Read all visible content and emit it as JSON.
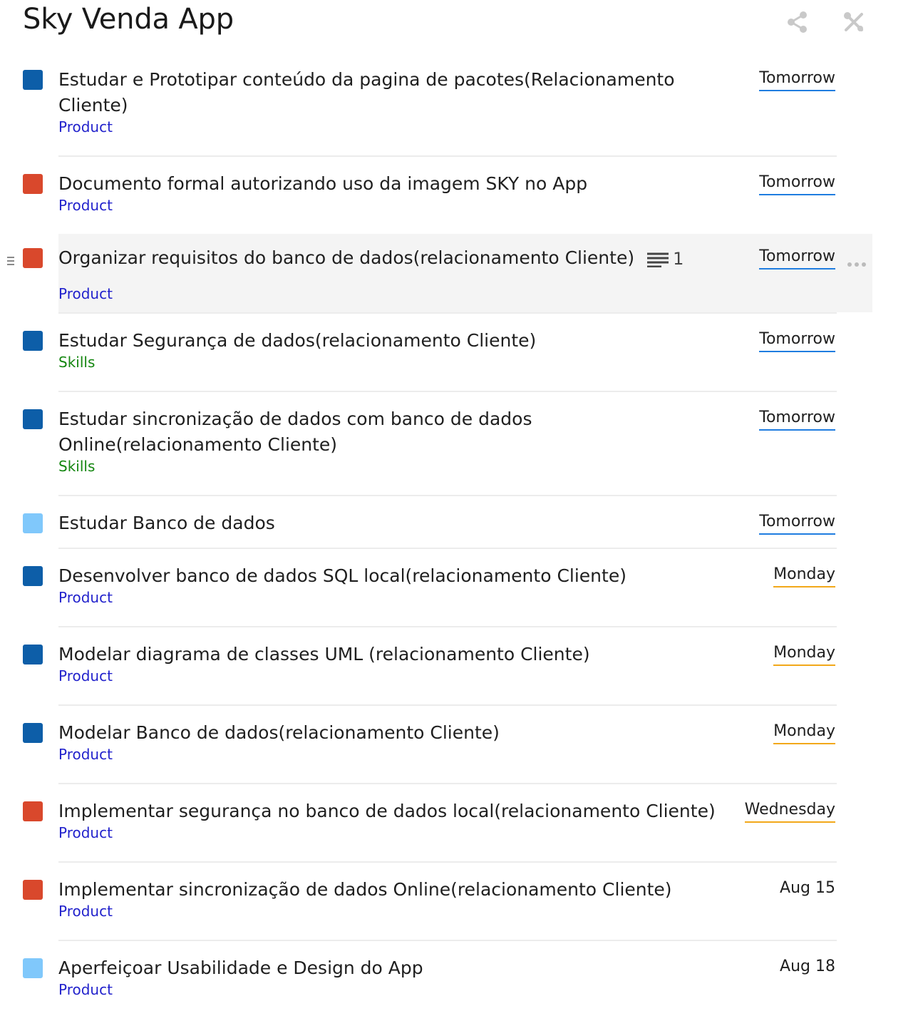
{
  "app": {
    "title": "Sky Venda App"
  },
  "colors": {
    "blue": "#0d5ea8",
    "red": "#d9482c",
    "light_blue": "#80c8fb",
    "product_tag": "#2222cc",
    "skills_tag": "#13860f",
    "tomorrow_underline": "#1f7de0",
    "weekday_underline": "#f2a81a"
  },
  "header": {
    "share_icon": "share-icon",
    "tools_icon": "tools-icon"
  },
  "tasks": [
    {
      "name": "Estudar e Prototipar conteúdo da pagina de pacotes(Relacionamento Cliente)",
      "project": "Product",
      "due": "Tomorrow",
      "color": "blue"
    },
    {
      "name": "Documento formal autorizando uso da imagem SKY no App",
      "project": "Product",
      "due": "Tomorrow",
      "color": "red"
    },
    {
      "name": "Organizar requisitos do banco de dados(relacionamento Cliente)",
      "project": "Product",
      "due": "Tomorrow",
      "color": "red",
      "comments": "1"
    },
    {
      "name": "Estudar Segurança de dados(relacionamento Cliente)",
      "project": "Skills",
      "due": "Tomorrow",
      "color": "blue"
    },
    {
      "name": "Estudar sincronização de dados com banco de dados Online(relacionamento Cliente)",
      "project": "Skills",
      "due": "Tomorrow",
      "color": "blue"
    },
    {
      "name": "Estudar Banco de dados",
      "project": "",
      "due": "Tomorrow",
      "color": "light_blue"
    },
    {
      "name": "Desenvolver banco de dados SQL local(relacionamento Cliente)",
      "project": "Product",
      "due": "Monday",
      "color": "blue"
    },
    {
      "name": "Modelar diagrama de classes UML (relacionamento Cliente)",
      "project": "Product",
      "due": "Monday",
      "color": "blue"
    },
    {
      "name": "Modelar Banco de dados(relacionamento Cliente)",
      "project": "Product",
      "due": "Monday",
      "color": "blue"
    },
    {
      "name": "Implementar segurança no banco de dados local(relacionamento Cliente)",
      "project": "Product",
      "due": "Wednesday",
      "color": "red"
    },
    {
      "name": "Implementar sincronização de dados Online(relacionamento Cliente)",
      "project": "Product",
      "due": "Aug 15",
      "color": "red"
    },
    {
      "name": "Aperfeiçoar Usabilidade e Design do App",
      "project": "Product",
      "due": "Aug 18",
      "color": "light_blue"
    }
  ]
}
